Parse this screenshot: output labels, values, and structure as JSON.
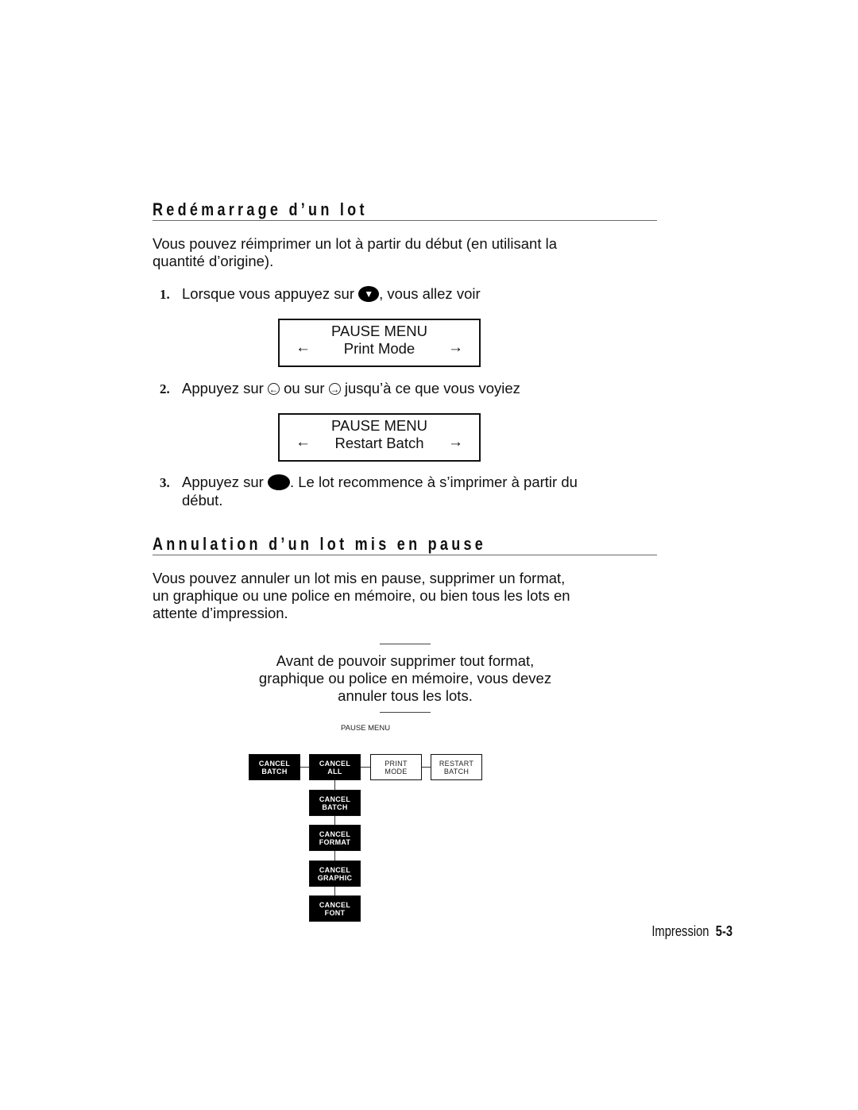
{
  "section1": {
    "heading": "Redémarrage d’un lot",
    "intro": "Vous pouvez réimprimer un lot à partir du début (en utilisant la quantité d’origine).",
    "intro_line1": "Vous pouvez réimprimer un lot à partir du début (en utilisant la",
    "intro_line2": "quantité d’origine).",
    "steps": [
      {
        "num": "1.",
        "before": "Lorsque vous appuyez sur ",
        "icon": "pause-button-icon",
        "after": ", vous allez voir"
      },
      {
        "num": "2.",
        "before": "Appuyez sur ",
        "icon_left": "left-arrow-button-icon",
        "middle": " ou sur ",
        "icon_right": "right-arrow-button-icon",
        "after": " jusqu’à ce que vous voyiez"
      },
      {
        "num": "3.",
        "before": "Appuyez sur ",
        "icon": "enter-button-icon",
        "after": ". Le lot recommence à s’imprimer à partir du",
        "after_line2": "début."
      }
    ],
    "displays": [
      {
        "line1": "PAUSE MENU",
        "line2": "Print Mode",
        "left_arrow": "←",
        "right_arrow": "→"
      },
      {
        "line1": "PAUSE MENU",
        "line2": "Restart Batch",
        "left_arrow": "←",
        "right_arrow": "→"
      }
    ]
  },
  "section2": {
    "heading": "Annulation d’un lot mis en pause",
    "intro_line1": "Vous pouvez annuler un lot mis en pause, supprimer un format,",
    "intro_line2": "un graphique ou une police en mémoire, ou bien tous les lots en",
    "intro_line3": "attente d’impression.",
    "note_line1": "Avant de pouvoir supprimer tout format,",
    "note_line2": "graphique ou police en mémoire, vous devez",
    "note_line3": "annuler tous les lots."
  },
  "diagram": {
    "title": "PAUSE MENU",
    "top_row": [
      {
        "l1": "CANCEL",
        "l2": "BATCH",
        "style": "dark"
      },
      {
        "l1": "CANCEL",
        "l2": "ALL",
        "style": "dark"
      },
      {
        "l1": "PRINT",
        "l2": "MODE",
        "style": "light"
      },
      {
        "l1": "RESTART",
        "l2": "BATCH",
        "style": "light"
      }
    ],
    "sub_items": [
      {
        "l1": "CANCEL",
        "l2": "BATCH"
      },
      {
        "l1": "CANCEL",
        "l2": "FORMAT"
      },
      {
        "l1": "CANCEL",
        "l2": "GRAPHIC"
      },
      {
        "l1": "CANCEL",
        "l2": "FONT"
      }
    ]
  },
  "footer": {
    "chapter": "Impression",
    "page": "5-3"
  }
}
